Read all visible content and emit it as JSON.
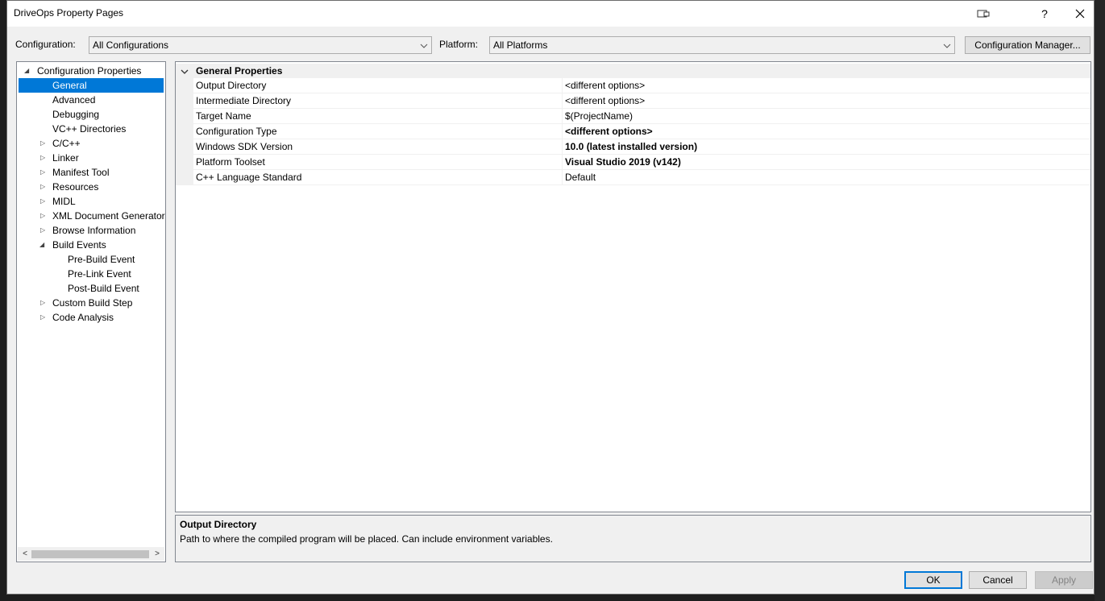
{
  "window": {
    "title": "DriveOps Property Pages",
    "help_label": "?"
  },
  "toolbar": {
    "configuration_label": "Configuration:",
    "configuration_value": "All Configurations",
    "platform_label": "Platform:",
    "platform_value": "All Platforms",
    "config_manager_label": "Configuration Manager..."
  },
  "tree": {
    "items": [
      {
        "label": "Configuration Properties",
        "expander": "expanded"
      },
      {
        "label": "General",
        "expander": "none",
        "selected": true
      },
      {
        "label": "Advanced",
        "expander": "none"
      },
      {
        "label": "Debugging",
        "expander": "none"
      },
      {
        "label": "VC++ Directories",
        "expander": "none"
      },
      {
        "label": "C/C++",
        "expander": "collapsed"
      },
      {
        "label": "Linker",
        "expander": "collapsed"
      },
      {
        "label": "Manifest Tool",
        "expander": "collapsed"
      },
      {
        "label": "Resources",
        "expander": "collapsed"
      },
      {
        "label": "MIDL",
        "expander": "collapsed"
      },
      {
        "label": "XML Document Generator",
        "expander": "collapsed"
      },
      {
        "label": "Browse Information",
        "expander": "collapsed"
      },
      {
        "label": "Build Events",
        "expander": "expanded"
      },
      {
        "label": "Pre-Build Event",
        "expander": "none"
      },
      {
        "label": "Pre-Link Event",
        "expander": "none"
      },
      {
        "label": "Post-Build Event",
        "expander": "none"
      },
      {
        "label": "Custom Build Step",
        "expander": "collapsed"
      },
      {
        "label": "Code Analysis",
        "expander": "collapsed"
      }
    ]
  },
  "grid": {
    "category": "General Properties",
    "rows": [
      {
        "name": "Output Directory",
        "value": "<different options>",
        "bold": false
      },
      {
        "name": "Intermediate Directory",
        "value": "<different options>",
        "bold": false
      },
      {
        "name": "Target Name",
        "value": "$(ProjectName)",
        "bold": false
      },
      {
        "name": "Configuration Type",
        "value": "<different options>",
        "bold": true
      },
      {
        "name": "Windows SDK Version",
        "value": "10.0 (latest installed version)",
        "bold": true
      },
      {
        "name": "Platform Toolset",
        "value": "Visual Studio 2019 (v142)",
        "bold": true
      },
      {
        "name": "C++ Language Standard",
        "value": "Default",
        "bold": false
      }
    ]
  },
  "description": {
    "title": "Output Directory",
    "text": "Path to where the compiled program will be placed. Can include environment variables."
  },
  "footer": {
    "ok_label": "OK",
    "cancel_label": "Cancel",
    "apply_label": "Apply"
  },
  "colors": {
    "selection": "#0078d7",
    "dialog_bg": "#f0f0f0",
    "editor_bg": "#1e1e1e"
  }
}
